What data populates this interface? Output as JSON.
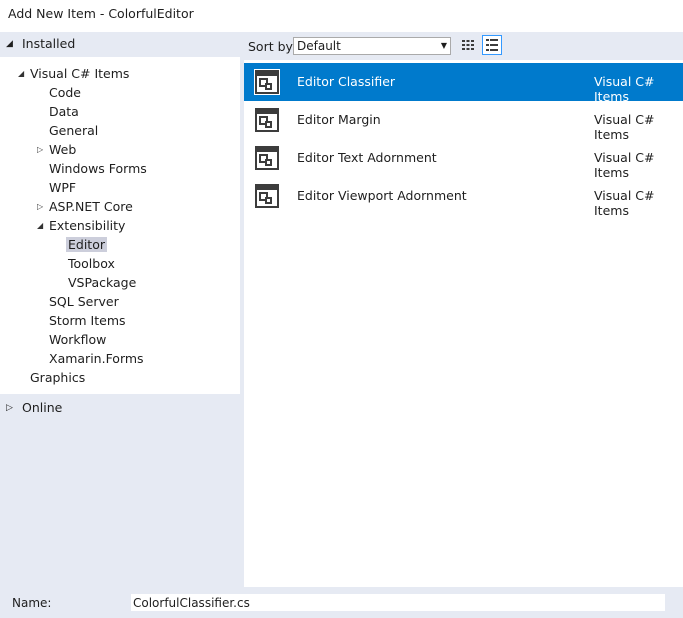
{
  "window": {
    "title": "Add New Item - ColorfulEditor"
  },
  "left_pane": {
    "installed_label": "Installed",
    "online_label": "Online",
    "tree": [
      {
        "label": "Visual C# Items",
        "caret": "expanded"
      },
      {
        "label": "Code"
      },
      {
        "label": "Data"
      },
      {
        "label": "General"
      },
      {
        "label": "Web",
        "caret": "collapsed"
      },
      {
        "label": "Windows Forms"
      },
      {
        "label": "WPF"
      },
      {
        "label": "ASP.NET Core",
        "caret": "collapsed"
      },
      {
        "label": "Extensibility",
        "caret": "expanded"
      },
      {
        "label": "Editor",
        "selected": true
      },
      {
        "label": "Toolbox"
      },
      {
        "label": "VSPackage"
      },
      {
        "label": "SQL Server"
      },
      {
        "label": "Storm Items"
      },
      {
        "label": "Workflow"
      },
      {
        "label": "Xamarin.Forms"
      },
      {
        "label": "Graphics"
      }
    ]
  },
  "toolbar": {
    "sort_label": "Sort by:",
    "sort_value": "Default",
    "view_icons": [
      "grid-view-icon",
      "list-view-icon"
    ]
  },
  "templates": [
    {
      "name": "Editor Classifier",
      "category": "Visual C# Items",
      "selected": true
    },
    {
      "name": "Editor Margin",
      "category": "Visual C# Items"
    },
    {
      "name": "Editor Text Adornment",
      "category": "Visual C# Items"
    },
    {
      "name": "Editor Viewport Adornment",
      "category": "Visual C# Items"
    }
  ],
  "bottom": {
    "name_label": "Name:",
    "name_value": "ColorfulClassifier.cs"
  },
  "colors": {
    "selection": "#007acc",
    "tree_selection": "#cccedb",
    "pane_background": "#e6eaf3",
    "icon_dark": "#3c3c3c"
  }
}
